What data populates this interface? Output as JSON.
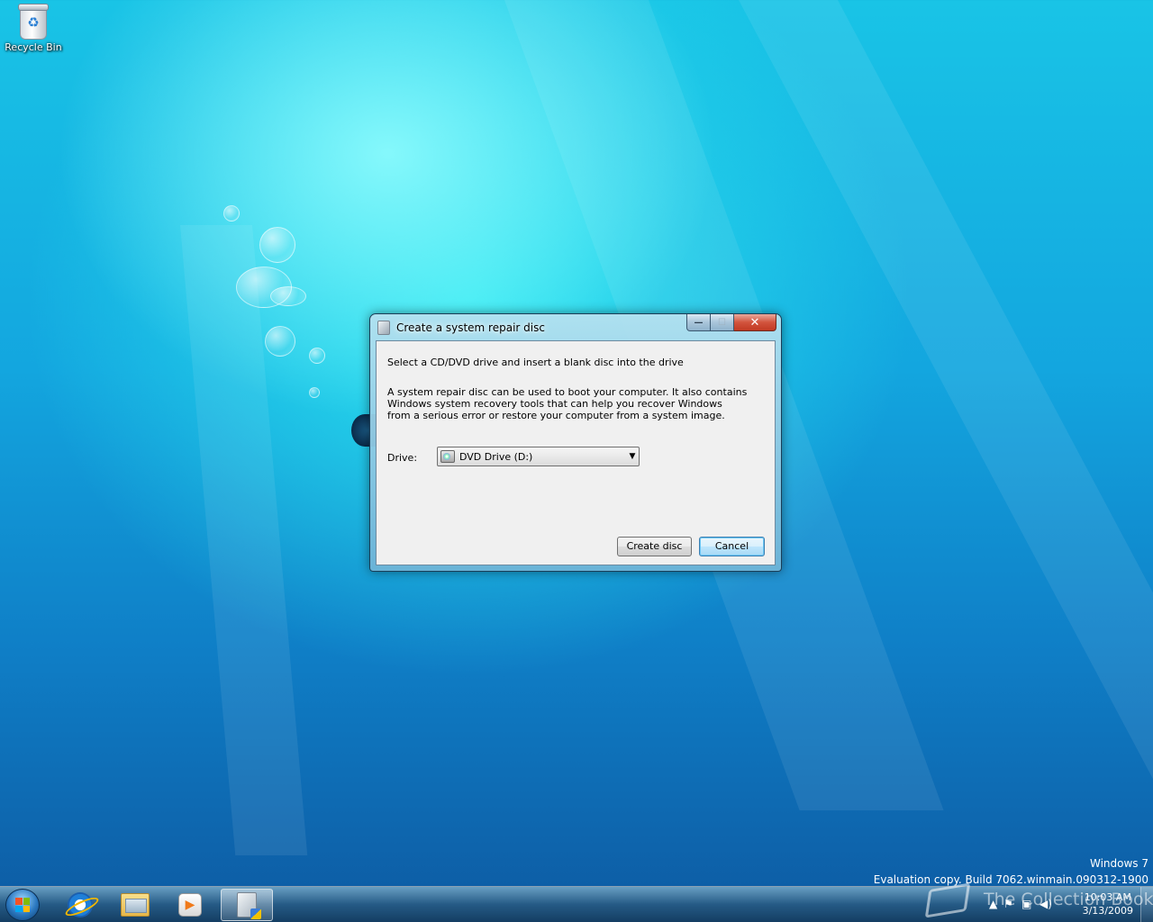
{
  "desktop": {
    "icons": [
      {
        "label": "Recycle Bin",
        "icon": "recycle-bin-icon"
      }
    ]
  },
  "dialog": {
    "title": "Create a system repair disc",
    "heading": "Select a CD/DVD drive and insert a blank disc into the drive",
    "description": "A system repair disc can be used to boot your computer. It also contains Windows system recovery tools that can help you recover Windows from a serious error or restore your computer from a system image.",
    "drive_label": "Drive:",
    "drive_value": "DVD Drive (D:)",
    "create_button": "Create disc",
    "cancel_button": "Cancel",
    "caption": {
      "minimize": "—",
      "maximize": "☐",
      "close": "✕"
    }
  },
  "watermark": {
    "line1": "Windows 7",
    "line2": "Evaluation copy. Build 7062.winmain.090312-1900"
  },
  "overlay": {
    "text": "The Collection Book"
  },
  "taskbar": {
    "pinned": [
      {
        "name": "Internet Explorer",
        "icon": "ie-icon"
      },
      {
        "name": "Windows Explorer",
        "icon": "folder-icon"
      },
      {
        "name": "Windows Media Player",
        "icon": "media-player-icon"
      },
      {
        "name": "Create a system repair disc",
        "icon": "repair-disc-icon",
        "active": true
      }
    ],
    "clock": {
      "time": "10:03 AM",
      "date": "3/13/2009"
    },
    "tray_icons": [
      "show-hidden-icon",
      "action-center-icon",
      "network-icon",
      "volume-icon"
    ]
  },
  "colors": {
    "desktop_top": "#19c4e6",
    "desktop_bottom": "#0d5aa2",
    "close_button": "#c13a23",
    "default_button_border": "#3c7fb1"
  }
}
